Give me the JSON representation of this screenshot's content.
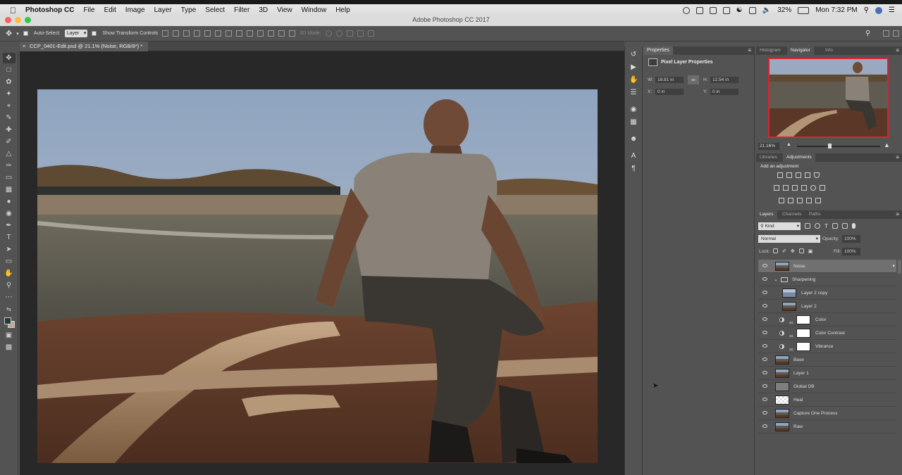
{
  "menubar": {
    "apple": "",
    "items": [
      "Photoshop CC",
      "File",
      "Edit",
      "Image",
      "Layer",
      "Type",
      "Select",
      "Filter",
      "3D",
      "View",
      "Window",
      "Help"
    ],
    "battery": "32%",
    "clock": "Mon 7:32 PM"
  },
  "window": {
    "title": "Adobe Photoshop CC 2017"
  },
  "options_bar": {
    "auto_select_label": "Auto-Select:",
    "auto_select_value": "Layer",
    "show_transform_label": "Show Transform Controls",
    "mode_3d_label": "3D Mode:"
  },
  "document": {
    "tab_label": "CCP_0401-Edit.psd @ 21.1% (Noise, RGB/8*) *"
  },
  "properties": {
    "tab": "Properties",
    "header": "Pixel Layer Properties",
    "w_label": "W:",
    "w_value": "18.81 in",
    "h_label": "H:",
    "h_value": "12.54 in",
    "x_label": "X:",
    "x_value": "0 in",
    "y_label": "Y:",
    "y_value": "0 in"
  },
  "navigator": {
    "tabs": [
      "Histogram",
      "Navigator",
      "Info"
    ],
    "active_tab": "Navigator",
    "zoom": "21.16%"
  },
  "adjustments": {
    "tabs": [
      "Libraries",
      "Adjustments"
    ],
    "active_tab": "Adjustments",
    "heading": "Add an adjustment"
  },
  "layers_panel": {
    "tabs": [
      "Layers",
      "Channels",
      "Paths"
    ],
    "active_tab": "Layers",
    "filter": "Kind",
    "blend_mode": "Normal",
    "opacity_label": "Opacity:",
    "opacity": "100%",
    "lock_label": "Lock:",
    "fill_label": "Fill:",
    "fill": "100%",
    "layers": [
      {
        "name": "Noise",
        "kind": "pixel",
        "selected": true
      },
      {
        "name": "Sharpening",
        "kind": "group"
      },
      {
        "name": "Layer 2 copy",
        "kind": "pixel",
        "indent": true
      },
      {
        "name": "Layer 2",
        "kind": "pixel",
        "indent": true
      },
      {
        "name": "Color",
        "kind": "adjustment"
      },
      {
        "name": "Color Contrast",
        "kind": "adjustment"
      },
      {
        "name": "Vibrance",
        "kind": "adjustment"
      },
      {
        "name": "Base",
        "kind": "pixel"
      },
      {
        "name": "Layer 1",
        "kind": "pixel"
      },
      {
        "name": "Global DB",
        "kind": "gray"
      },
      {
        "name": "Heal",
        "kind": "transparent"
      },
      {
        "name": "Capture One Process",
        "kind": "pixel"
      },
      {
        "name": "Raw",
        "kind": "pixel"
      }
    ]
  },
  "colors": {
    "ui_bg": "#535353",
    "canvas_bg": "#282828",
    "selection_red": "#dd2233"
  }
}
